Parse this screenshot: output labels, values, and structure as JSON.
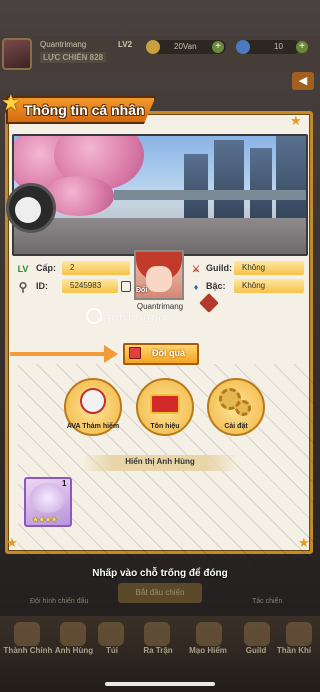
{
  "hud": {
    "player_name": "Quantrimang",
    "level": "LV2",
    "power": "LỰC CHIẾN 828",
    "gold": "20Van",
    "gems": "10"
  },
  "panel": {
    "title": "Thông tin cá nhân",
    "level_label": "Cấp:",
    "level_value": "2",
    "id_label": "ID:",
    "id_value": "5245983",
    "guild_label": "Guild:",
    "guild_value": "Không",
    "rank_label": "Bậc:",
    "rank_value": "Không",
    "avatar_button": "Đổi",
    "player_name": "Quantrimang",
    "watermark": "uantrimang",
    "gift_button": "Đổi quà",
    "features": [
      {
        "label": "AVA Thám hiểm",
        "icon": "robot-icon"
      },
      {
        "label": "Tôn hiệu",
        "icon": "crown-icon"
      },
      {
        "label": "Cài đặt",
        "icon": "gears-icon"
      }
    ],
    "heroes_header": "Hiển thị Anh Hùng",
    "hero_card": {
      "count": "1",
      "stars": "★★★★"
    }
  },
  "footer": {
    "hint": "Nhấp vào chỗ trống để đóng",
    "bg_button": "Bắt đầu chiến",
    "left_label": "Đội hình chiến đấu",
    "right_label": "Tác chiến"
  },
  "bottom_nav": [
    {
      "label": "Thành Chính"
    },
    {
      "label": "Anh Hùng"
    },
    {
      "label": "Túi"
    },
    {
      "label": "Ra Trận"
    },
    {
      "label": "Mạo Hiểm"
    },
    {
      "label": "Guild"
    },
    {
      "label": "Thần Khí"
    }
  ],
  "colors": {
    "accent": "#f29a2b",
    "panel_bg": "#f4f0e6",
    "gold_box": "#f5c24a",
    "arrow": "#f39a3a"
  }
}
